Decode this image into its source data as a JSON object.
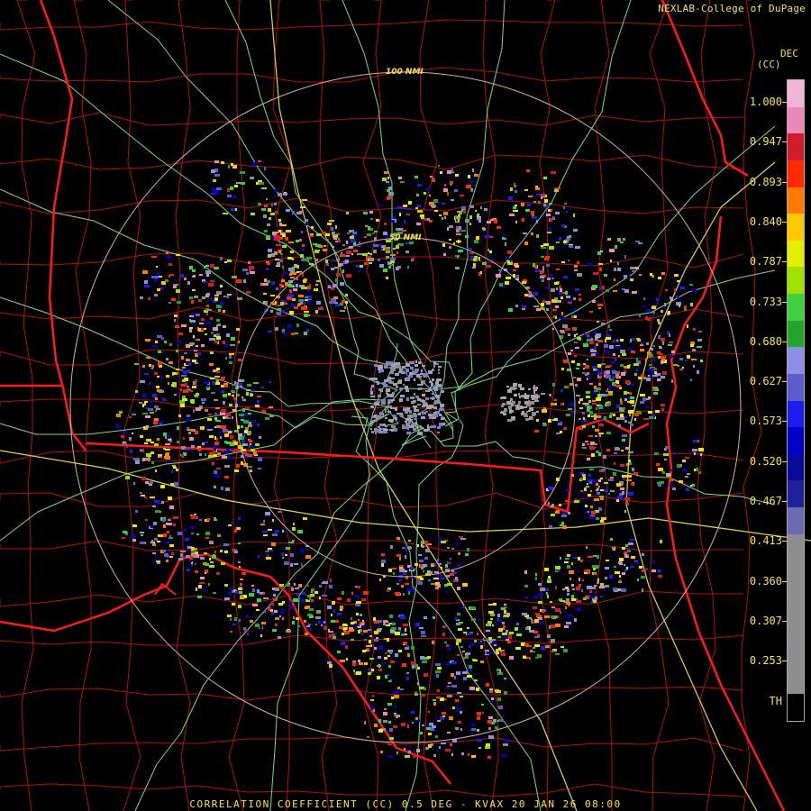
{
  "credit": "NEXLAB-College of DuPage",
  "product_caption": "CORRELATION COEFFICIENT (CC) 0.5 DEG - KVAX 20 JAN 26 08:00",
  "radar_site": "KVAX",
  "range_rings": [
    {
      "label": "50 NMI"
    },
    {
      "label": "100 NMI"
    }
  ],
  "color_scale": {
    "title_line1": "DEC",
    "title_line2": "(CC)",
    "labels": [
      "1.000",
      "0.947",
      "0.893",
      "0.840",
      "0.787",
      "0.733",
      "0.680",
      "0.627",
      "0.573",
      "0.520",
      "0.467",
      "0.413",
      "0.360",
      "0.307",
      "0.253",
      "TH"
    ],
    "colors": [
      "#f3b5d5",
      "#e98bb6",
      "#d01d2a",
      "#ff2a00",
      "#ff7a00",
      "#ffc800",
      "#e2f000",
      "#9ee000",
      "#3fd040",
      "#22a52a",
      "#8e8ee6",
      "#5c5ccc",
      "#1c1cf0",
      "#0000c8",
      "#0a0a9a",
      "#20209a",
      "#6b6bb0",
      "#8d8d8d",
      "#8d8d8d",
      "#8d8d8d",
      "#8d8d8d",
      "#8d8d8d",
      "#8d8d8d",
      "#000000"
    ]
  },
  "map_colors": {
    "state_border": "#ff1a1a",
    "county_border": "#b01010",
    "roads": "#7fd88a",
    "interstates": "#e6d84a",
    "range_ring": "#d9b39a"
  }
}
